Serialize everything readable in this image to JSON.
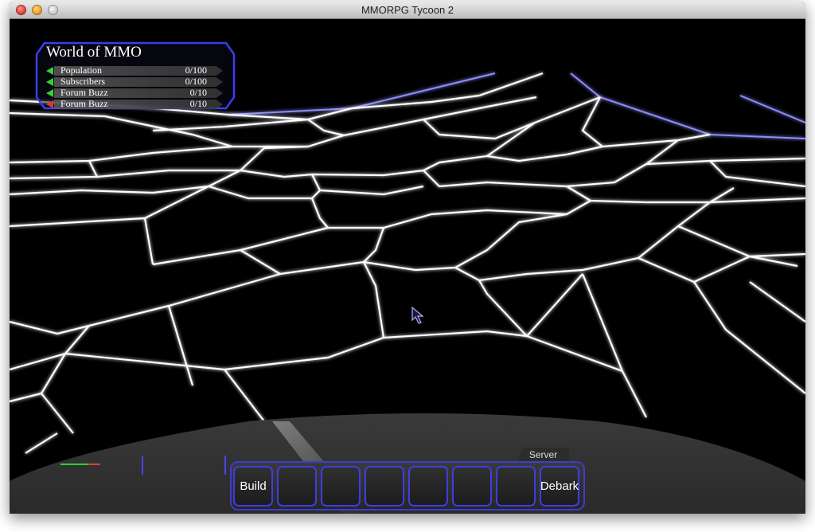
{
  "window": {
    "title": "MMORPG Tycoon 2"
  },
  "status_panel": {
    "title": "World of MMO",
    "stats": [
      {
        "label": "Population",
        "value": "0/100",
        "trend": "up",
        "arrow_color": "#38d038"
      },
      {
        "label": "Subscribers",
        "value": "0/100",
        "trend": "up",
        "arrow_color": "#38d038"
      },
      {
        "label": "Forum Buzz",
        "value": "0/10",
        "trend": "up",
        "arrow_color": "#38d038"
      },
      {
        "label": "Forum Buzz",
        "value": "0/10",
        "trend": "down",
        "arrow_color": "#e03434"
      }
    ]
  },
  "toolbar": {
    "tab_label": "Server",
    "build_label": "Build",
    "debark_label": "Debark",
    "empty_slots": 6
  },
  "colors": {
    "mesh_line": "#ffffff",
    "mesh_far_line": "#8c8cff",
    "accent_blue": "#3e3ee0",
    "ground": "#333333"
  },
  "icons": [
    "mouse-pointer-icon",
    "trend-up-arrow-icon",
    "trend-down-arrow-icon"
  ]
}
